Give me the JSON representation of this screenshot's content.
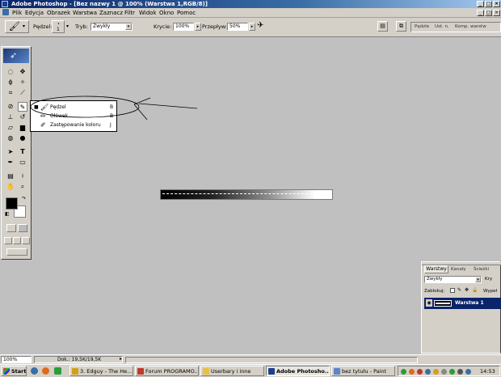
{
  "window": {
    "title": "Adobe Photoshop - [Bez nazwy 1 @ 100% (Warstwa 1,RGB/8)]"
  },
  "menu": {
    "items": [
      "Plik",
      "Edycja",
      "Obrazek",
      "Warstwa",
      "Zaznacz",
      "Filtr",
      "Widok",
      "Okno",
      "Pomoc"
    ]
  },
  "options": {
    "brush_label": "Pędzel:",
    "brush_size": "1",
    "mode_label": "Tryb:",
    "mode_value": "Zwykły",
    "opacity_label": "Krycie:",
    "opacity_value": "100%",
    "flow_label": "Przepływ:",
    "flow_value": "50%",
    "palette_tabs": [
      "Pędzle",
      "Ust. n.",
      "Komp. warstw"
    ]
  },
  "tool_flyout": {
    "items": [
      {
        "label": "Pędzel",
        "shortcut": "B",
        "selected": true
      },
      {
        "label": "Ołówek",
        "shortcut": "B",
        "selected": false
      },
      {
        "label": "Zastępowanie koloru",
        "shortcut": "J",
        "selected": false
      }
    ]
  },
  "layers_panel": {
    "tabs": [
      "Warstwy",
      "Kanały",
      "Ścieżki"
    ],
    "blend_mode": "Zwykły",
    "opacity_label": "Kry",
    "lock_label": "Zablokuj:",
    "fill_label": "Wypeł",
    "layer_name": "Warstwa 1"
  },
  "status": {
    "zoom": "100%",
    "doc_info": "Dok.: 19,5K/19,5K"
  },
  "taskbar": {
    "start_label": "Start",
    "tasks": [
      "3. Edguy - The He...",
      "Forum PROGRAMO...",
      "Userbary i inne",
      "Adobe Photosho...",
      "bez tytułu - Paint"
    ],
    "clock": "14:53"
  },
  "colors": {
    "title_bar": "#0a246a",
    "workspace": "#c0c0c0",
    "chrome": "#d4d0c8",
    "selection": "#0a246a",
    "foreground": "#000000",
    "background": "#ffffff"
  }
}
